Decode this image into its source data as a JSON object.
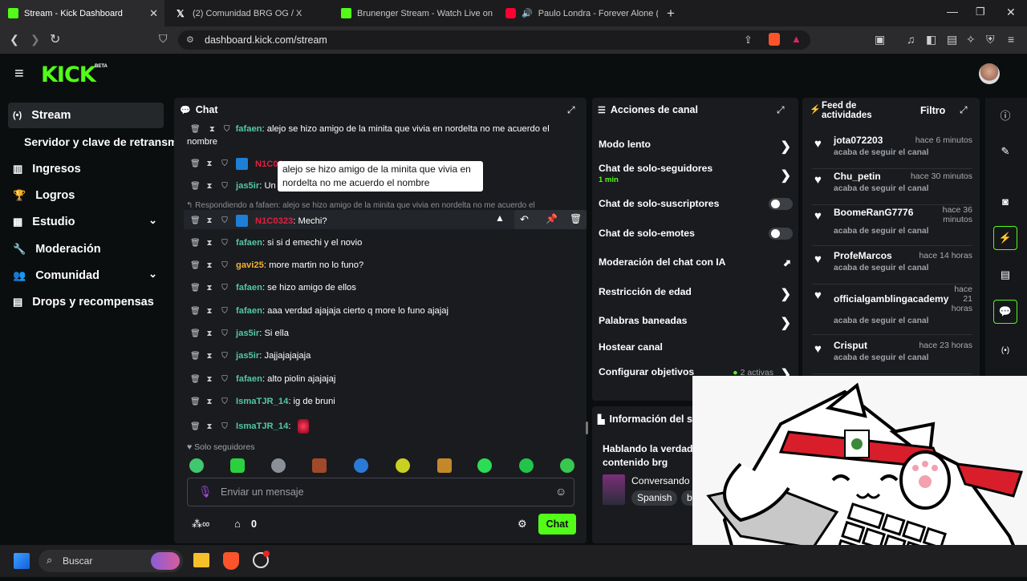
{
  "browser": {
    "tabs": [
      {
        "title": "Stream - Kick Dashboard",
        "icon_color": "#53fc18"
      },
      {
        "title": "(2) Comunidad BRG OG / X",
        "icon_color": "#ffffff"
      },
      {
        "title": "Brunenger Stream - Watch Live on Ki",
        "icon_color": "#53fc18"
      },
      {
        "title": "Paulo Londra - Forever Alone (Of",
        "icon_color": "#ff0033"
      }
    ],
    "url": "dashboard.kick.com/stream"
  },
  "header": {
    "logo": "KICK",
    "logo_beta": "BETA"
  },
  "sidebar": {
    "items": [
      {
        "label": "Stream",
        "icon": "stream-icon"
      },
      {
        "label": "Servidor y clave de retransm",
        "icon": ""
      },
      {
        "label": "Ingresos",
        "icon": "chart-icon"
      },
      {
        "label": "Logros",
        "icon": "trophy-icon"
      },
      {
        "label": "Estudio",
        "icon": "grid-icon"
      },
      {
        "label": "Moderación",
        "icon": "wrench-icon"
      },
      {
        "label": "Comunidad",
        "icon": "people-icon"
      },
      {
        "label": "Drops y recompensas",
        "icon": "drops-icon"
      }
    ]
  },
  "chat": {
    "title": "Chat",
    "tooltip": "alejo se hizo amigo de la minita que vivia en nordelta no me acuerdo el nombre",
    "reply_banner": "Respondiendo a fafaen: alejo se hizo amigo de la minita que vivia en nordelta no me acuerdo el",
    "messages": [
      {
        "user": "fafaen",
        "color": "#53c8a0",
        "text": "alejo se hizo amigo de la minita que vivia en nordelta no me acuerdo el",
        "text2": "nombre"
      },
      {
        "user": "N1C03",
        "color": "#e02040",
        "text": ""
      },
      {
        "user": "jas5ir",
        "color": "#53c8a0",
        "text": "Un"
      },
      {
        "user": "N1C0323",
        "color": "#e02040",
        "text": "Mechi?"
      },
      {
        "user": "fafaen",
        "color": "#53c8a0",
        "text": "si si d emechi y el novio"
      },
      {
        "user": "gavi25",
        "color": "#f2b233",
        "text": "more martin no lo funo?"
      },
      {
        "user": "fafaen",
        "color": "#53c8a0",
        "text": "se hizo amigo de ellos"
      },
      {
        "user": "fafaen",
        "color": "#53c8a0",
        "text": "aaa verdad ajajaja cierto q more lo funo ajajaj"
      },
      {
        "user": "jas5ir",
        "color": "#53c8a0",
        "text": "Si ella"
      },
      {
        "user": "jas5ir",
        "color": "#53c8a0",
        "text": "Jajjajajajaja"
      },
      {
        "user": "fafaen",
        "color": "#53c8a0",
        "text": "alto piolin ajajajaj"
      },
      {
        "user": "IsmaTJR_14",
        "color": "#53c8a0",
        "text": "ig de bruni"
      },
      {
        "user": "IsmaTJR_14",
        "color": "#53c8a0",
        "text": ""
      }
    ],
    "followers_only": "Solo seguidores",
    "input_placeholder": "Enviar un mensaje",
    "points": "0",
    "send_label": "Chat"
  },
  "channel_actions": {
    "title": "Acciones de canal",
    "items": [
      {
        "label": "Modo lento",
        "sub": "",
        "control": "chevron"
      },
      {
        "label": "Chat de solo-seguidores",
        "sub": "1 min",
        "control": "chevron"
      },
      {
        "label": "Chat de solo-suscriptores",
        "sub": "",
        "control": "toggle"
      },
      {
        "label": "Chat de solo-emotes",
        "sub": "",
        "control": "toggle"
      },
      {
        "label": "Moderación del chat con IA",
        "sub": "",
        "control": "external"
      },
      {
        "label": "Restricción de edad",
        "sub": "",
        "control": "chevron"
      },
      {
        "label": "Palabras baneadas",
        "sub": "",
        "control": "chevron"
      },
      {
        "label": "Hostear canal",
        "sub": "",
        "control": "none"
      },
      {
        "label": "Configurar objetivos",
        "sub": "2 activas",
        "control": "chevron"
      }
    ]
  },
  "stream_info": {
    "title": "Información del st",
    "stream_title_1": "Hablando la verdad",
    "stream_title_2": "contenido brg",
    "category": "Conversando",
    "language": "Spanish",
    "tag_partial": "b"
  },
  "activity_feed": {
    "title_1": "Feed de",
    "title_2": "actividades",
    "filter_label": "Filtro",
    "items": [
      {
        "user": "jota072203",
        "time": "hace 6 minutos",
        "action": "acaba de seguir el canal"
      },
      {
        "user": "Chu_petin",
        "time": "hace 30 minutos",
        "action": "acaba de seguir el canal"
      },
      {
        "user": "BoomeRanG7776",
        "time": "hace 36 minutos",
        "action": "acaba de seguir el canal"
      },
      {
        "user": "ProfeMarcos",
        "time": "hace 14 horas",
        "action": "acaba de seguir el canal"
      },
      {
        "user": "officialgamblingacademy",
        "time": "hace 21 horas",
        "action": "acaba de seguir el canal"
      },
      {
        "user": "Crisput",
        "time": "hace 23 horas",
        "action": "acaba de seguir el canal"
      }
    ]
  },
  "taskbar": {
    "search_placeholder": "Buscar"
  },
  "colors": {
    "brand": "#53fc18",
    "panel": "#191b1f",
    "background": "#0b0e0f"
  }
}
